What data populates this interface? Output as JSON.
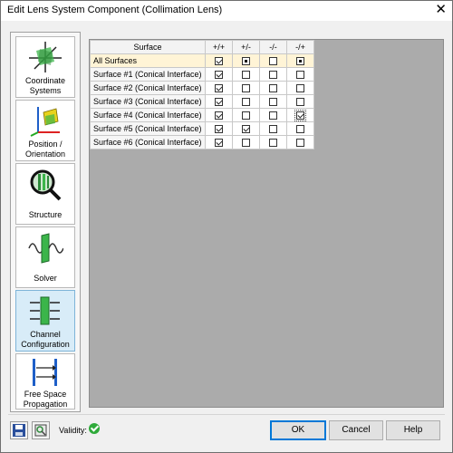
{
  "window": {
    "title": "Edit Lens System Component (Collimation Lens)",
    "close_glyph": "✕"
  },
  "sidebar": {
    "items": [
      {
        "label_lines": [
          "Coordinate",
          "Systems"
        ],
        "icon": "coordinate-systems-icon"
      },
      {
        "label_lines": [
          "Position /",
          "Orientation"
        ],
        "icon": "position-orientation-icon"
      },
      {
        "label_lines": [
          "Structure"
        ],
        "icon": "structure-icon"
      },
      {
        "label_lines": [
          "Solver"
        ],
        "icon": "solver-icon"
      },
      {
        "label_lines": [
          "Channel",
          "Configuration"
        ],
        "icon": "channel-configuration-icon",
        "selected": true
      },
      {
        "label_lines": [
          "Free Space",
          "Propagation"
        ],
        "icon": "free-space-propagation-icon"
      }
    ]
  },
  "table": {
    "headers": [
      "Surface",
      "+/+",
      "+/-",
      "-/-",
      "-/+"
    ],
    "rows": [
      {
        "name": "All Surfaces",
        "states": [
          "checked",
          "mixed",
          "unchecked",
          "mixed"
        ]
      },
      {
        "name": "Surface #1 (Conical Interface)",
        "states": [
          "checked",
          "unchecked",
          "unchecked",
          "unchecked"
        ]
      },
      {
        "name": "Surface #2 (Conical Interface)",
        "states": [
          "checked",
          "unchecked",
          "unchecked",
          "unchecked"
        ]
      },
      {
        "name": "Surface #3 (Conical Interface)",
        "states": [
          "checked",
          "unchecked",
          "unchecked",
          "unchecked"
        ]
      },
      {
        "name": "Surface #4 (Conical Interface)",
        "states": [
          "checked",
          "unchecked",
          "unchecked",
          "checked-focus"
        ]
      },
      {
        "name": "Surface #5 (Conical Interface)",
        "states": [
          "checked",
          "checked",
          "unchecked",
          "unchecked"
        ]
      },
      {
        "name": "Surface #6 (Conical Interface)",
        "states": [
          "checked",
          "unchecked",
          "unchecked",
          "unchecked"
        ]
      }
    ]
  },
  "footer": {
    "save_icon": "save-icon",
    "catalog_icon": "catalog-icon",
    "validity_label": "Validity:",
    "validity_status": "valid",
    "ok_label": "OK",
    "cancel_label": "Cancel",
    "help_label": "Help"
  },
  "colors": {
    "content_bg": "#ababab",
    "selected_nav": "#d8ecf8",
    "all_row": "#fff4d6",
    "valid_green": "#2faa3a"
  }
}
